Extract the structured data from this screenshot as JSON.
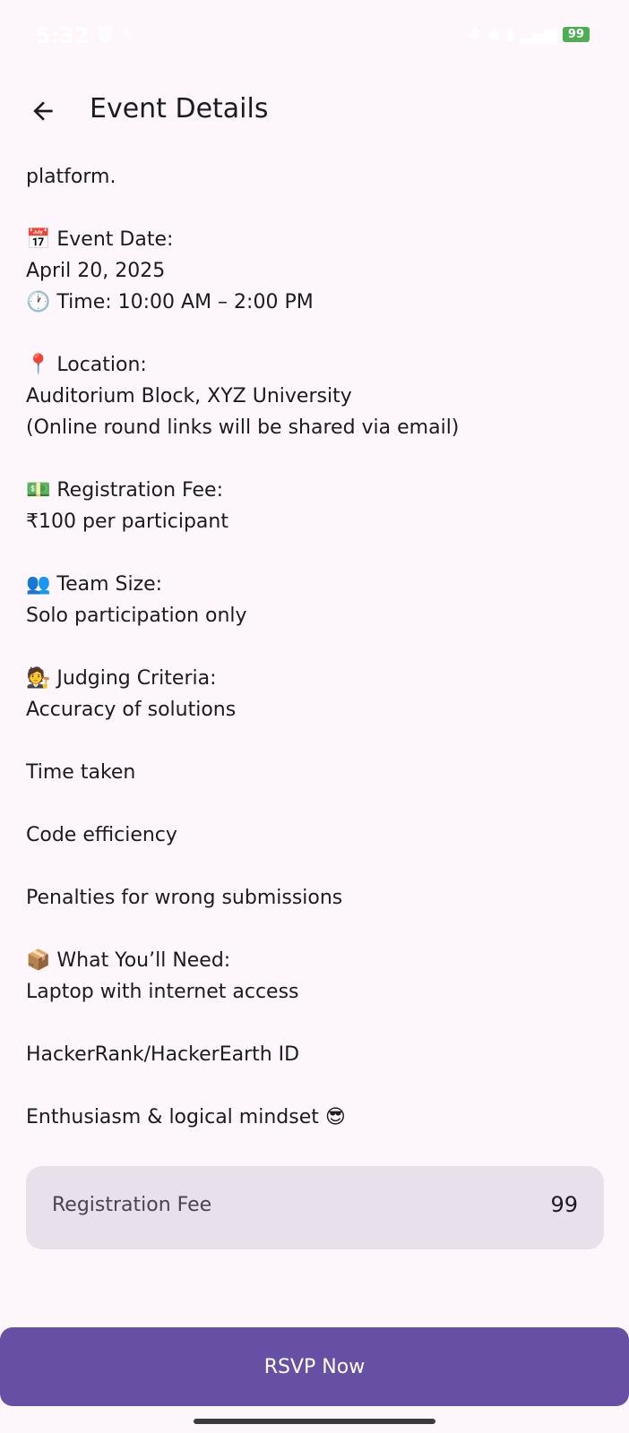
{
  "status_bar": {
    "time": "5:32",
    "left_icons": "🗑 ✳",
    "right_icons": "✱ ◉ ▮ ▂▄▆",
    "battery": "99"
  },
  "app_bar": {
    "title": "Event Details",
    "back_icon": "arrow-left-icon"
  },
  "content": {
    "lines": [
      "platform.",
      "",
      "📅 Event Date:",
      "April 20, 2025",
      "🕐 Time: 10:00 AM – 2:00 PM",
      "",
      "📍 Location:",
      "Auditorium Block, XYZ University",
      "(Online round links will be shared via email)",
      "",
      "💵 Registration Fee:",
      "₹100 per participant",
      "",
      "👥 Team Size:",
      "Solo participation only",
      "",
      "🧑‍⚖️ Judging Criteria:",
      "Accuracy of solutions",
      "",
      "Time taken",
      "",
      "Code efficiency",
      "",
      "Penalties for wrong submissions",
      "",
      "📦 What You’ll Need:",
      "Laptop with internet access",
      "",
      "HackerRank/HackerEarth ID",
      "",
      "Enthusiasm & logical mindset 😎"
    ]
  },
  "fee_card": {
    "label": "Registration Fee",
    "value": "99"
  },
  "rsvp_button": {
    "label": "RSVP Now"
  },
  "colors": {
    "background": "#fdf7fc",
    "primary": "#6750a4",
    "card": "#e8e0eb",
    "text": "#1c1b1f"
  }
}
